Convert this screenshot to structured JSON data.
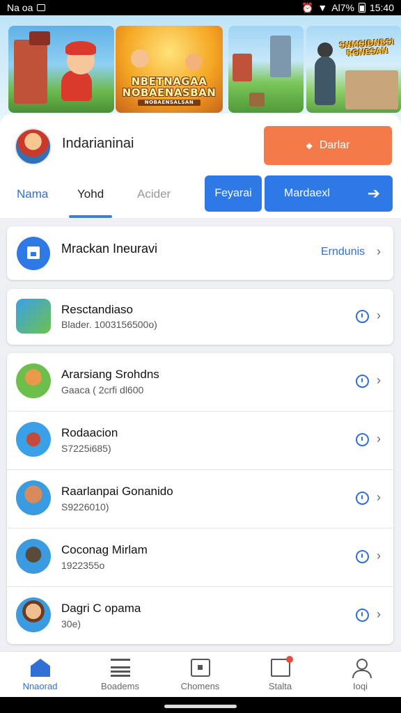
{
  "status_bar": {
    "left_text": "Na oa",
    "right_text": "Al7%",
    "time": "15:40"
  },
  "banner": {
    "tile2_title": "NBETNAGAA NOBAENASBAN",
    "tile2_subtitle": "NOBAENSALSAN",
    "tile4_logo": "SNMSIDNBSI RGNESAN"
  },
  "header": {
    "username": "Indarianinai",
    "primary_button": "Darlar",
    "tabs": [
      "Nama",
      "Yohd",
      "Acider"
    ],
    "small_button": "Feyarai",
    "wide_button": "Mardaexl"
  },
  "featured": {
    "title": "Mrackan Ineuravi",
    "link": "Erndunis"
  },
  "items": [
    {
      "title": "Resctandiaso",
      "subtitle": "Blader. 1003156500o)"
    },
    {
      "title": "Ararsiang Srohdns",
      "subtitle": "Gaaca ( 2crfi dl600"
    },
    {
      "title": "Rodaacion",
      "subtitle": "S7225i685)"
    },
    {
      "title": "Raarlanpai Gonanido",
      "subtitle": "S9226010)"
    },
    {
      "title": "Coconag Mirlam",
      "subtitle": "1922355o"
    },
    {
      "title": "Dagri C opama",
      "subtitle": "30e)"
    }
  ],
  "bottom_nav": [
    "Nnaorad",
    "Boadems",
    "Chomens",
    "Stalta",
    "Ioqi"
  ],
  "colors": {
    "accent_blue": "#2f79e6",
    "orange": "#f47a4a"
  }
}
